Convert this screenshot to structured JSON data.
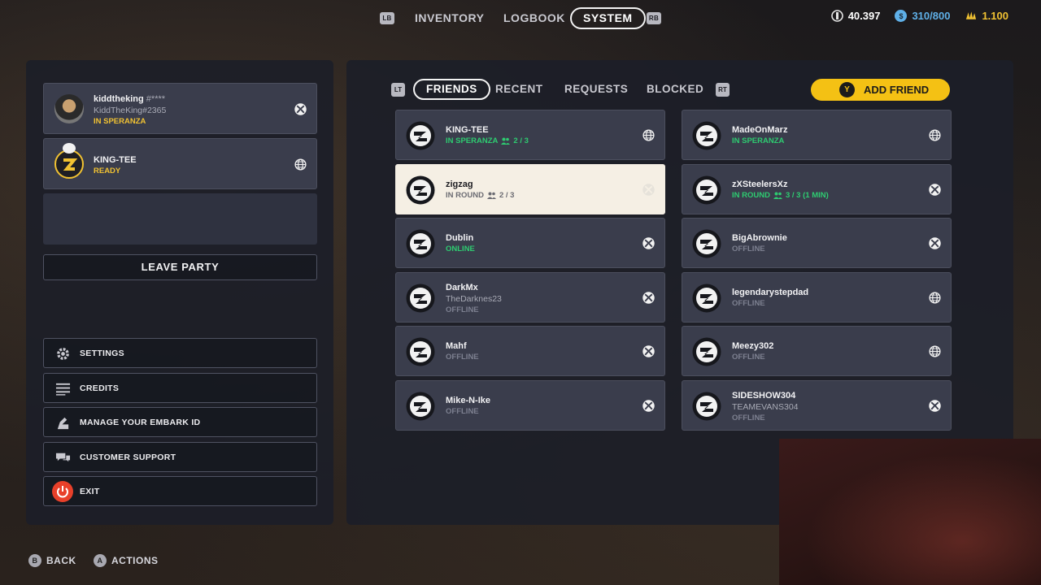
{
  "nav": {
    "lb": "LB",
    "rb": "RB",
    "tabs": [
      {
        "label": "INVENTORY"
      },
      {
        "label": "LOGBOOK"
      },
      {
        "label": "SYSTEM",
        "active": true
      }
    ]
  },
  "currencies": [
    {
      "icon": "coins-icon",
      "value": "40.397",
      "color": "#ffffff"
    },
    {
      "icon": "bucket-icon",
      "value": "310/800",
      "color": "#5fb0e8"
    },
    {
      "icon": "multibucks-icon",
      "value": "1.100",
      "color": "#f1c232"
    }
  ],
  "party": {
    "members": [
      {
        "name": "kiddtheking",
        "tag": "#****",
        "sub": "KiddTheKing#2365",
        "status": "IN SPERANZA",
        "platform": "xbox-icon"
      },
      {
        "name": "KING-TEE",
        "status": "READY",
        "platform": "globe-icon"
      }
    ],
    "leave_label": "LEAVE PARTY"
  },
  "menu": [
    {
      "label": "SETTINGS",
      "icon": "gear-icon"
    },
    {
      "label": "CREDITS",
      "icon": "credits-icon"
    },
    {
      "label": "MANAGE YOUR EMBARK ID",
      "icon": "id-icon"
    },
    {
      "label": "CUSTOMER SUPPORT",
      "icon": "chat-icon"
    },
    {
      "label": "EXIT",
      "icon": "power-icon"
    }
  ],
  "friends_tabs": {
    "lt": "LT",
    "rt": "RT",
    "tabs": [
      {
        "label": "FRIENDS",
        "active": true
      },
      {
        "label": "RECENT"
      },
      {
        "label": "REQUESTS"
      },
      {
        "label": "BLOCKED"
      }
    ],
    "add_friend_key": "Y",
    "add_friend_label": "ADD FRIEND"
  },
  "friends": [
    {
      "name": "KING-TEE",
      "status": "IN SPERANZA",
      "party": "2 / 3",
      "tone": "green",
      "platform": "globe-icon"
    },
    {
      "name": "MadeOnMarz",
      "status": "IN SPERANZA",
      "tone": "green",
      "platform": "globe-icon"
    },
    {
      "name": "zigzag",
      "status": "IN ROUND",
      "party": "2 / 3",
      "tone": "dark",
      "platform": "xbox-icon",
      "selected": true
    },
    {
      "name": "zXSteelersXz",
      "status": "IN ROUND",
      "party": "3 / 3 (1 MIN)",
      "tone": "green",
      "platform": "xbox-icon"
    },
    {
      "name": "Dublin",
      "status": "ONLINE",
      "tone": "green",
      "platform": "xbox-icon"
    },
    {
      "name": "BigAbrownie",
      "status": "OFFLINE",
      "tone": "gray",
      "platform": "xbox-icon"
    },
    {
      "name": "DarkMx",
      "sub": "TheDarknes23",
      "status": "OFFLINE",
      "tone": "gray",
      "platform": "xbox-icon"
    },
    {
      "name": "legendarystepdad",
      "status": "OFFLINE",
      "tone": "gray",
      "platform": "globe-icon"
    },
    {
      "name": "Mahf",
      "status": "OFFLINE",
      "tone": "gray",
      "platform": "xbox-icon"
    },
    {
      "name": "Meezy302",
      "status": "OFFLINE",
      "tone": "gray",
      "platform": "globe-icon"
    },
    {
      "name": "Mike-N-Ike",
      "status": "OFFLINE",
      "tone": "gray",
      "platform": "xbox-icon"
    },
    {
      "name": "SIDESHOW304",
      "sub": "TEAMEVANS304",
      "status": "OFFLINE",
      "tone": "gray",
      "platform": "xbox-icon"
    }
  ],
  "hints": [
    {
      "key": "B",
      "label": "BACK"
    },
    {
      "key": "A",
      "label": "ACTIONS"
    }
  ],
  "colors": {
    "accent_yellow": "#f4c114",
    "status_green": "#2ecc71",
    "exit_red": "#e8402a"
  }
}
